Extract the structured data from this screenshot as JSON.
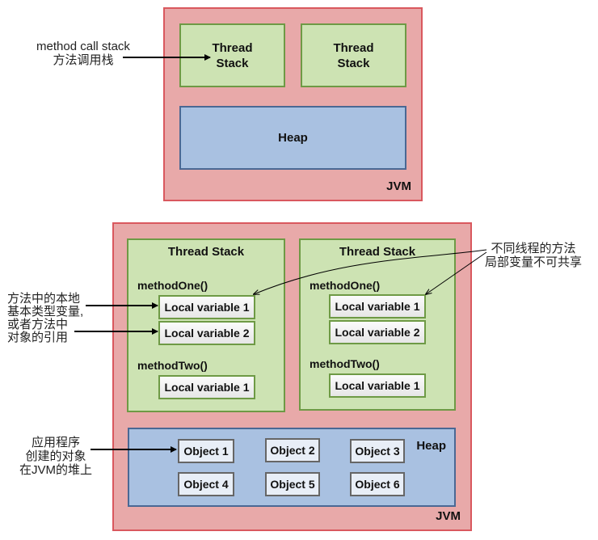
{
  "top_diagram": {
    "jvm_label": "JVM",
    "thread_stacks": [
      "Thread\nStack",
      "Thread\nStack"
    ],
    "heap_label": "Heap",
    "annotation": {
      "line1": "method call stack",
      "line2": "方法调用栈"
    }
  },
  "bottom_diagram": {
    "jvm_label": "JVM",
    "heap_label": "Heap",
    "thread_stacks": [
      {
        "title": "Thread Stack",
        "methods": [
          {
            "name": "methodOne()",
            "variables": [
              "Local variable 1",
              "Local variable 2"
            ]
          },
          {
            "name": "methodTwo()",
            "variables": [
              "Local variable 1"
            ]
          }
        ]
      },
      {
        "title": "Thread Stack",
        "methods": [
          {
            "name": "methodOne()",
            "variables": [
              "Local variable 1",
              "Local variable 2"
            ]
          },
          {
            "name": "methodTwo()",
            "variables": [
              "Local variable 1"
            ]
          }
        ]
      }
    ],
    "objects": [
      "Object 1",
      "Object 2",
      "Object 3",
      "Object 4",
      "Object 5",
      "Object 6"
    ],
    "annotations": {
      "local_vars": [
        "方法中的本地",
        "基本类型变量,",
        "或者方法中",
        "对象的引用"
      ],
      "not_shared": [
        "不同线程的方法",
        "局部变量不可共享"
      ],
      "heap_objects": [
        "应用程序",
        "创建的对象",
        "在JVM的堆上"
      ]
    }
  },
  "colors": {
    "jvm_fill": "#e8a9a9",
    "jvm_border": "#d9585e",
    "thread_stack_fill": "#cde3b3",
    "thread_stack_border": "#6e9a45",
    "heap_fill": "#a9c1e1",
    "heap_border": "#4a6894"
  }
}
